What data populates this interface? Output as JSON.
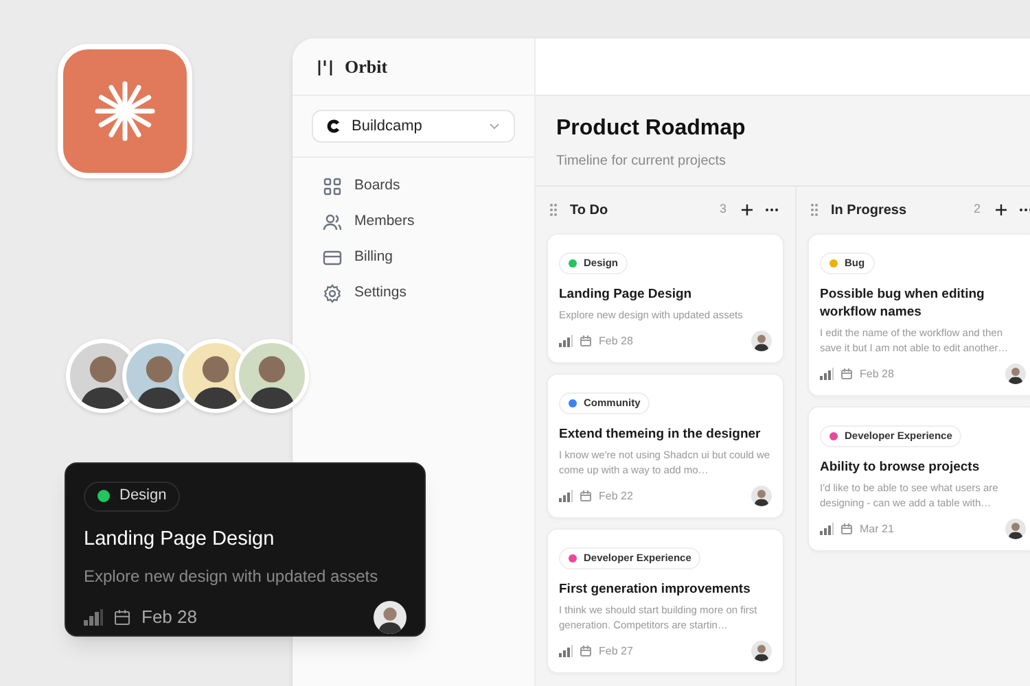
{
  "app": {
    "logo": "Orbit",
    "workspace": "Buildcamp",
    "nav": [
      {
        "label": "Boards",
        "kind": "boards"
      },
      {
        "label": "Members",
        "kind": "members"
      },
      {
        "label": "Billing",
        "kind": "billing"
      },
      {
        "label": "Settings",
        "kind": "settings"
      }
    ],
    "title": "Product Roadmap",
    "subtitle": "Timeline for current projects",
    "columns": [
      {
        "title": "To Do",
        "count": "3",
        "cards": [
          {
            "tag": {
              "label": "Design",
              "color": "#22c55e"
            },
            "title": "Landing Page Design",
            "description": "Explore new design with updated assets",
            "date": "Feb 28"
          },
          {
            "tag": {
              "label": "Community",
              "color": "#3b82f6"
            },
            "title": "Extend themeing in the designer",
            "description": "I know we're not using Shadcn ui but could we come up with a way to add mo…",
            "date": "Feb 22"
          },
          {
            "tag": {
              "label": "Developer Experience",
              "color": "#ec4899"
            },
            "title": "First generation improvements",
            "description": "I think we should start building more on first generation. Competitors are startin…",
            "date": "Feb 27"
          }
        ]
      },
      {
        "title": "In Progress",
        "count": "2",
        "cards": [
          {
            "tag": {
              "label": "Bug",
              "color": "#eab308"
            },
            "title": "Possible bug when editing workflow names",
            "description": "I edit the name of the workflow and then save it but I am not able to edit another…",
            "date": "Feb 28"
          },
          {
            "tag": {
              "label": "Developer Experience",
              "color": "#ec4899"
            },
            "title": "Ability to browse projects",
            "description": "I'd like to be able to see what users are designing - can we add a table with…",
            "date": "Mar 21"
          }
        ]
      }
    ]
  },
  "featured_card": {
    "tag": {
      "label": "Design",
      "color": "#22c55e"
    },
    "title": "Landing Page Design",
    "description": "Explore new design with updated assets",
    "date": "Feb 28"
  }
}
